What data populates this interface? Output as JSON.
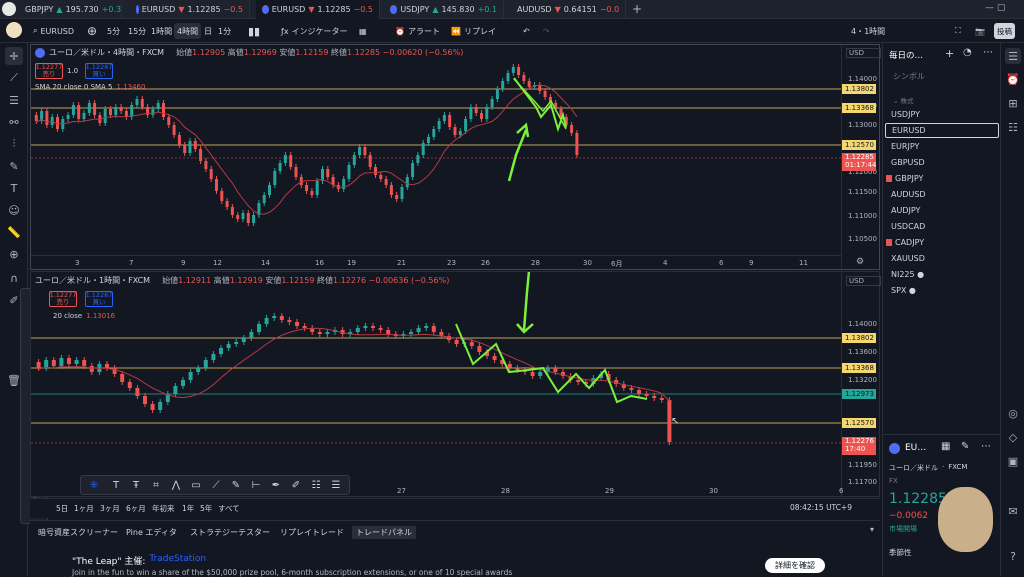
{
  "tabs": [
    {
      "sym": "GBPJPY",
      "dir": "▲",
      "price": "195.730",
      "chg": "+0.3",
      "color": "#26a69a",
      "active": false
    },
    {
      "sym": "EURUSD",
      "dir": "▼",
      "price": "1.12285",
      "chg": "−0.5",
      "color": "#ef5350",
      "active": false
    },
    {
      "sym": "EURUSD",
      "dir": "▼",
      "price": "1.12285",
      "chg": "−0.5",
      "color": "#ef5350",
      "active": true
    },
    {
      "sym": "USDJPY",
      "dir": "▲",
      "price": "145.830",
      "chg": "+0.1",
      "color": "#26a69a",
      "active": false
    },
    {
      "sym": "AUDUSD",
      "dir": "▼",
      "price": "0.64151",
      "chg": "−0.0",
      "color": "#ef5350",
      "active": false
    }
  ],
  "toolbar": {
    "symbol": "EURUSD",
    "intervals": [
      "5分",
      "15分",
      "1時間",
      "4時間",
      "日",
      "1分"
    ],
    "selected_interval": "4時間",
    "indicators": "インジケーター",
    "alert": "アラート",
    "replay": "リプレイ",
    "timeframe": "4・1時間",
    "publish": "投稿"
  },
  "chart1": {
    "title": "ユーロ／米ドル・4時間・FXCM",
    "ohlc": {
      "o_label": "始値",
      "o": "1.12905",
      "h_label": "高値",
      "h": "1.12969",
      "l_label": "安値",
      "l": "1.12159",
      "c_label": "終値",
      "c": "1.12285",
      "chg": "−0.00620 (−0.56%)"
    },
    "sell": {
      "price": "1.12277",
      "label": "売り"
    },
    "qty": "1.0",
    "buy": {
      "price": "1.12287",
      "label": "買い"
    },
    "ma_label": "SMA 20 close 0 SMA 5",
    "ma_value": "1.13460",
    "currency": "USD",
    "y_ticks": [
      "1.14000",
      "1.13500",
      "1.13000",
      "1.12000",
      "1.11500",
      "1.11000",
      "1.10500"
    ],
    "tags": [
      {
        "v": "1.13802",
        "bg": "#f5d76e"
      },
      {
        "v": "1.13368",
        "bg": "#f5d76e"
      },
      {
        "v": "1.12570",
        "bg": "#f5d76e"
      },
      {
        "v": "1.12285",
        "bg": "#ef5350"
      }
    ],
    "countdown": "01:17:44",
    "x_ticks": [
      "3",
      "7",
      "9",
      "12",
      "14",
      "16",
      "19",
      "21",
      "23",
      "26",
      "28",
      "30",
      "6月",
      "4",
      "6",
      "9",
      "11"
    ]
  },
  "chart2": {
    "title": "ユーロ／米ドル・1時間・FXCM",
    "ohlc": {
      "o_label": "始値",
      "o": "1.12911",
      "h_label": "高値",
      "h": "1.12919",
      "l_label": "安値",
      "l": "1.12159",
      "c_label": "終値",
      "c": "1.12276",
      "chg": "−0.00636 (−0.56%)"
    },
    "sell": {
      "price": "1.12277",
      "label": "売り"
    },
    "buy": {
      "price": "1.12287",
      "label": "買い"
    },
    "ma_label": "20 close",
    "ma_value": "1.13016",
    "currency": "USD",
    "y_ticks": [
      "1.14000",
      "1.13600",
      "1.13200",
      "1.11950",
      "1.11700"
    ],
    "tags": [
      {
        "v": "1.13802",
        "bg": "#f5d76e"
      },
      {
        "v": "1.13368",
        "bg": "#f5d76e"
      },
      {
        "v": "1.12973",
        "bg": "#26a69a"
      },
      {
        "v": "1.12570",
        "bg": "#f5d76e"
      },
      {
        "v": "1.12276",
        "bg": "#ef5350"
      }
    ],
    "countdown": "17:40",
    "x_ticks": [
      "27",
      "28",
      "29",
      "30",
      "6"
    ]
  },
  "bottomnav": {
    "ranges": [
      "5日",
      "1ヶ月",
      "3ヶ月",
      "6ヶ月",
      "年初来",
      "1年",
      "5年",
      "すべて"
    ],
    "clock": "08:42:15 UTC+9"
  },
  "bottompanel": {
    "tabs": [
      "暗号資産スクリーナー",
      "Pine エディタ",
      "ストラテジーテスター",
      "リプレイトレード",
      "トレードパネル"
    ],
    "selected": "トレードパネル",
    "promo_title": "\"The Leap\" 主催:",
    "promo_brand": "TradeStation",
    "promo_text": "Join in the fun to win a share of the $50,000 prize pool, 6-month subscription extensions, or one of 10 special awards",
    "promo_button": "詳細を確認"
  },
  "watchlist": {
    "title": "毎日の…",
    "symbol_header": "シンボル",
    "section": "株式",
    "items": [
      "USDJPY",
      "EURUSD",
      "EURJPY",
      "GBPUSD",
      "GBPJPY",
      "AUDUSD",
      "AUDJPY",
      "USDCAD",
      "CADJPY",
      "XAUUSD",
      "NI225 ●",
      "SPX ●"
    ],
    "selected": "EURUSD",
    "flagged": [
      "GBPJPY",
      "CADJPY"
    ]
  },
  "details": {
    "sym": "EU…",
    "name": "ユーロ／米ドル",
    "source": "FXCM",
    "type": "FX",
    "price": "1.12285",
    "chg": "−0.0062",
    "status": "市場開場",
    "season": "季節性"
  }
}
